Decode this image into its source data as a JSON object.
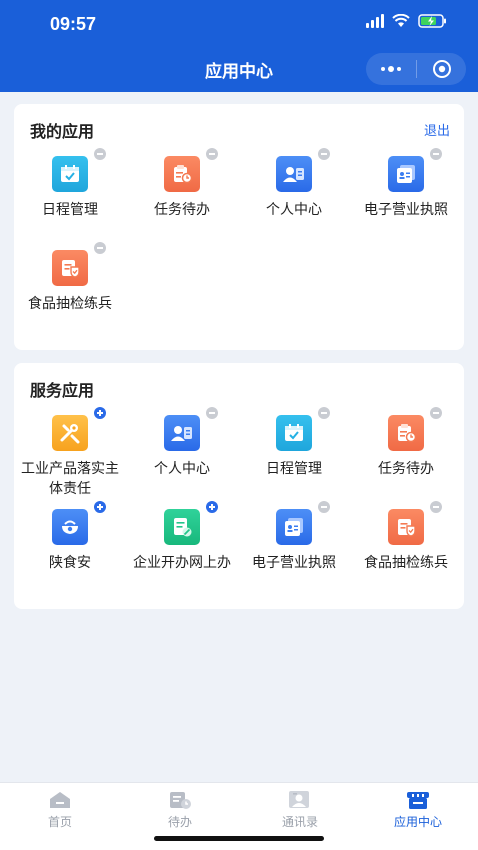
{
  "status_bar": {
    "time": "09:57"
  },
  "nav": {
    "title": "应用中心"
  },
  "my_apps": {
    "title": "我的应用",
    "logout_label": "退出",
    "items": [
      {
        "label": "日程管理",
        "icon": "calendar-icon",
        "color": "#25b1e4",
        "badge": "minus"
      },
      {
        "label": "任务待办",
        "icon": "task-icon",
        "color": "#f47a52",
        "badge": "minus"
      },
      {
        "label": "个人中心",
        "icon": "profile-card-icon",
        "color": "#3b7df0",
        "badge": "minus"
      },
      {
        "label": "电子营业执照",
        "icon": "license-icon",
        "color": "#3b7df0",
        "badge": "minus"
      },
      {
        "label": "食品抽检练兵",
        "icon": "food-inspection-icon",
        "color": "#f47a52",
        "badge": "minus"
      }
    ]
  },
  "service_apps": {
    "title": "服务应用",
    "items": [
      {
        "label": "工业产品落实主体责任",
        "icon": "tools-icon",
        "color": "#fbb033",
        "badge": "plus"
      },
      {
        "label": "个人中心",
        "icon": "profile-card-icon",
        "color": "#3b7df0",
        "badge": "minus"
      },
      {
        "label": "日程管理",
        "icon": "calendar-icon",
        "color": "#25b1e4",
        "badge": "minus"
      },
      {
        "label": "任务待办",
        "icon": "task-icon",
        "color": "#f47a52",
        "badge": "minus"
      },
      {
        "label": "陕食安",
        "icon": "food-bowl-icon",
        "color": "#3b7df0",
        "badge": "plus"
      },
      {
        "label": "企业开办网上办",
        "icon": "document-edit-icon",
        "color": "#22c58a",
        "badge": "plus"
      },
      {
        "label": "电子营业执照",
        "icon": "license-icon",
        "color": "#3b7df0",
        "badge": "minus"
      },
      {
        "label": "食品抽检练兵",
        "icon": "food-inspection-icon",
        "color": "#f47a52",
        "badge": "minus"
      }
    ]
  },
  "tabbar": {
    "items": [
      {
        "label": "首页",
        "icon": "home-icon",
        "active": false
      },
      {
        "label": "待办",
        "icon": "todo-icon",
        "active": false
      },
      {
        "label": "通讯录",
        "icon": "contacts-icon",
        "active": false
      },
      {
        "label": "应用中心",
        "icon": "app-store-icon",
        "active": true
      }
    ]
  }
}
